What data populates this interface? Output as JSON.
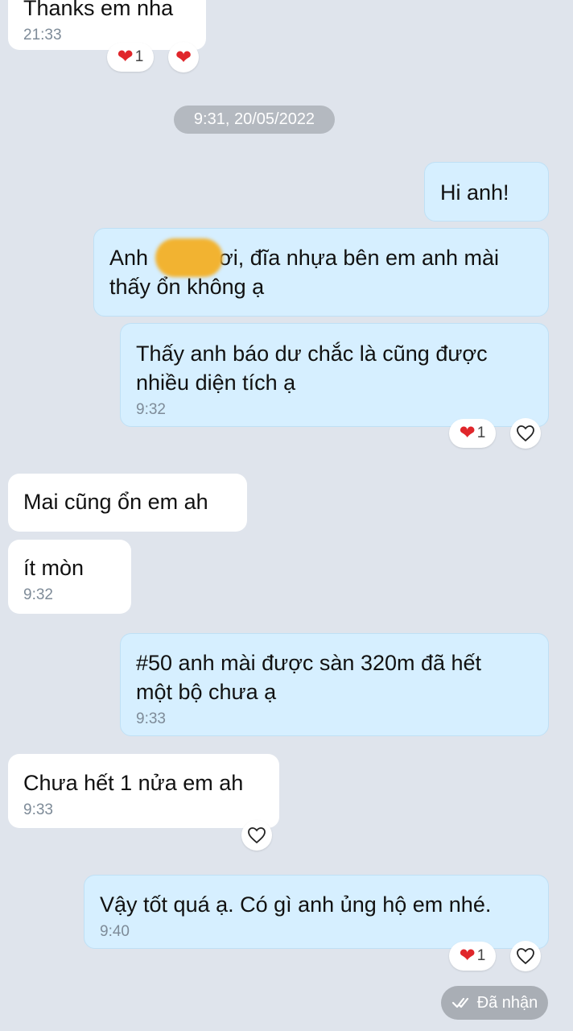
{
  "messages": {
    "m0": {
      "text": "Thanks em nha",
      "time": "21:33"
    },
    "date_separator": "9:31, 20/05/2022",
    "m1": {
      "text": "Hi anh!"
    },
    "m2": {
      "text_a": "Anh",
      "text_b": "ơi, đĩa nhựa bên em anh mài",
      "text_c": "thấy ổn không ạ"
    },
    "m3": {
      "line1": "Thấy anh báo dư chắc là cũng được",
      "line2": "nhiều diện tích ạ",
      "time": "9:32"
    },
    "m4": {
      "text": "Mai cũng ổn em ah"
    },
    "m5": {
      "text": "ít mòn",
      "time": "9:32"
    },
    "m6": {
      "line1": "#50 anh mài được sàn 320m đã hết",
      "line2": "một bộ chưa ạ",
      "time": "9:33"
    },
    "m7": {
      "text": "Chưa hết 1 nửa em ah",
      "time": "9:33"
    },
    "m8": {
      "text": "Vậy tốt quá ạ. Có gì anh ủng hộ em nhé.",
      "time": "9:40"
    }
  },
  "reactions": {
    "r0": {
      "icon": "heart-red",
      "count": "1"
    },
    "r3": {
      "icon": "heart-red",
      "count": "1"
    },
    "r8": {
      "icon": "heart-red",
      "count": "1"
    }
  },
  "status": {
    "label": "Đã nhận"
  },
  "colors": {
    "incoming": "#ffffff",
    "outgoing": "#d6efff",
    "background": "#dfe4ec",
    "heart": "#e0262b"
  }
}
